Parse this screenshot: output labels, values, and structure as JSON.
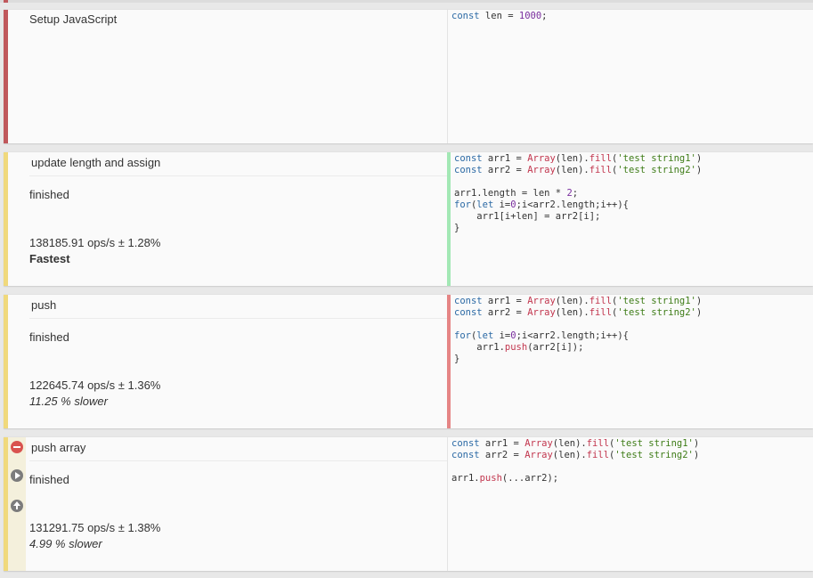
{
  "colors": {
    "setup_stripe": "#c0585c",
    "test_stripe": "#f0d97c",
    "fastest_bar": "#a3e8b5",
    "slower_bar": "#e58585"
  },
  "setup": {
    "title": "Setup JavaScript",
    "code": [
      "const len = 1000;"
    ]
  },
  "tests": [
    {
      "title": "update length and assign",
      "status": "finished",
      "ops": "138185.91 ops/s ± 1.28%",
      "verdict": "Fastest",
      "code": [
        "const arr1 = Array(len).fill('test string1')",
        "const arr2 = Array(len).fill('test string2')",
        "",
        "arr1.length = len * 2;",
        "for(let i=0;i<arr2.length;i++){",
        "    arr1[i+len] = arr2[i];",
        "}"
      ]
    },
    {
      "title": "push",
      "status": "finished",
      "ops": "122645.74 ops/s ± 1.36%",
      "verdict": "11.25 % slower",
      "code": [
        "const arr1 = Array(len).fill('test string1')",
        "const arr2 = Array(len).fill('test string2')",
        "",
        "for(let i=0;i<arr2.length;i++){",
        "    arr1.push(arr2[i]);",
        "}"
      ]
    },
    {
      "title": "push array",
      "status": "finished",
      "ops": "131291.75 ops/s ± 1.38%",
      "verdict": "4.99 % slower",
      "code": [
        "const arr1 = Array(len).fill('test string1')",
        "const arr2 = Array(len).fill('test string2')",
        "",
        "arr1.push(...arr2);"
      ]
    }
  ],
  "icons": [
    "remove-icon",
    "play-icon",
    "move-up-icon"
  ]
}
